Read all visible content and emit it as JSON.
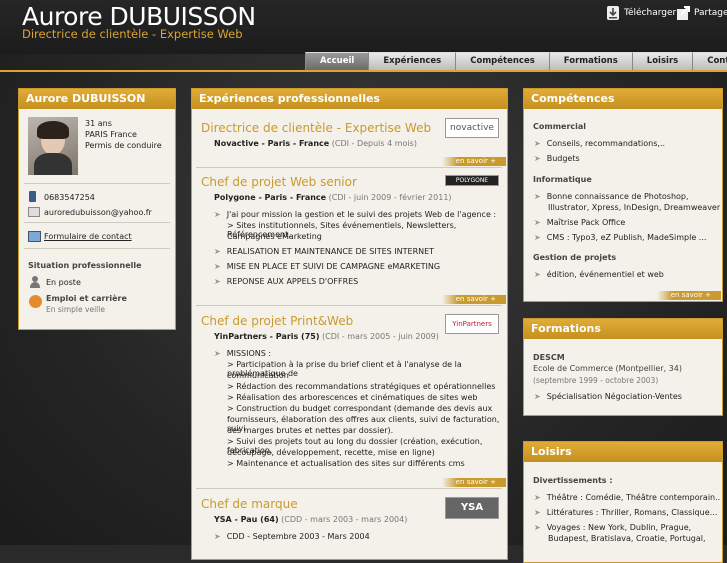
{
  "header": {
    "name": "Aurore DUBUISSON",
    "subtitle": "Directrice de clientèle - Expertise Web",
    "download": "Télécharger",
    "share": "Partager"
  },
  "nav": [
    "Accueil",
    "Expériences",
    "Compétences",
    "Formations",
    "Loisirs",
    "Contact"
  ],
  "profile": {
    "title": "Aurore DUBUISSON",
    "age": "31 ans",
    "location": "PARIS France",
    "license": "Permis de conduire",
    "phone": "0683547254",
    "email": "auroredubuisson@yahoo.fr",
    "contact": "Formulaire de contact",
    "situation_title": "Situation professionnelle",
    "status": "En poste",
    "employment": "Emploi et carrière",
    "watch": "En simple veille"
  },
  "experiences": {
    "title": "Expériences professionnelles",
    "more": "en savoir +",
    "jobs": [
      {
        "title": "Directrice de clientèle - Expertise Web",
        "company": "Novactive - Paris - France",
        "dates": "(CDI - Depuis 4 mois)",
        "logo": "novactive",
        "items": []
      },
      {
        "title": "Chef de projet Web senior",
        "company": "Polygone - Paris - France",
        "dates": "(CDI - juin 2009 - février 2011)",
        "logo": "POLYGONE",
        "items": [
          "J'ai pour mission la gestion et le suivi des projets Web de l'agence :",
          "> Sites institutionnels, Sites événementiels, Newsletters, Référencement,",
          "Campagnes eMarketing",
          "REALISATION ET MAINTENANCE DE SITES INTERNET",
          "MISE EN PLACE ET SUIVI DE CAMPAGNE eMARKETING",
          "REPONSE AUX APPELS D'OFFRES"
        ]
      },
      {
        "title": "Chef de projet Print&Web",
        "company": "YinPartners - Paris (75)",
        "dates": "(CDI - mars 2005 - juin 2009)",
        "logo": "YinPartners",
        "items": [
          "MISSIONS :",
          "> Participation à la prise du brief client et à l'analyse de la problématique de",
          "communication",
          "> Rédaction des recommandations stratégiques et opérationnelles",
          "> Réalisation des arborescences et cinématiques de sites web",
          "> Construction du budget correspondant (demande des devis aux",
          "fournisseurs, élaboration des offres aux clients, suivi de facturation, suivi",
          "des marges brutes et nettes par dossier).",
          "> Suivi des projets tout au long du dossier (création, exécution, fabrication,",
          "découpage, développement, recette, mise en ligne)",
          "> Maintenance et actualisation des sites sur différents cms"
        ]
      },
      {
        "title": "Chef de marque",
        "company": "YSA - Pau (64)",
        "dates": "(CDD - mars 2003 - mars 2004)",
        "logo": "YSA",
        "items": [
          "CDD - Septembre 2003 - Mars 2004"
        ]
      }
    ]
  },
  "skills": {
    "title": "Compétences",
    "more": "en savoir +",
    "commercial_title": "Commercial",
    "commercial": [
      "Conseils, recommandations,..",
      "Budgets"
    ],
    "it_title": "Informatique",
    "it": [
      "Bonne connaissance de Photoshop,",
      "Illustrator, Xpress, InDesign, Dreamweaver",
      "Maîtrise Pack Office",
      "CMS : Typo3, eZ Publish, MadeSimple ..."
    ],
    "pm_title": "Gestion de projets",
    "pm": [
      "édition, événementiel et web"
    ]
  },
  "education": {
    "title": "Formations",
    "degree": "DESCM",
    "school": "Ecole de Commerce (Montpellier, 34)",
    "dates": "(septembre 1999 - octobre 2003)",
    "spec": "Spécialisation Négociation-Ventes"
  },
  "hobbies": {
    "title": "Loisirs",
    "sub": "Divertissements :",
    "items": [
      "Théâtre : Comédie, Théâtre contemporain..",
      "Littératures : Thriller, Romans, Classique...",
      "Voyages : New York, Dublin, Prague,",
      "Budapest, Bratislava, Croatie, Portugal,"
    ]
  },
  "colors": {
    "accent": "#c99a2e",
    "header_text": "#d9a431"
  }
}
